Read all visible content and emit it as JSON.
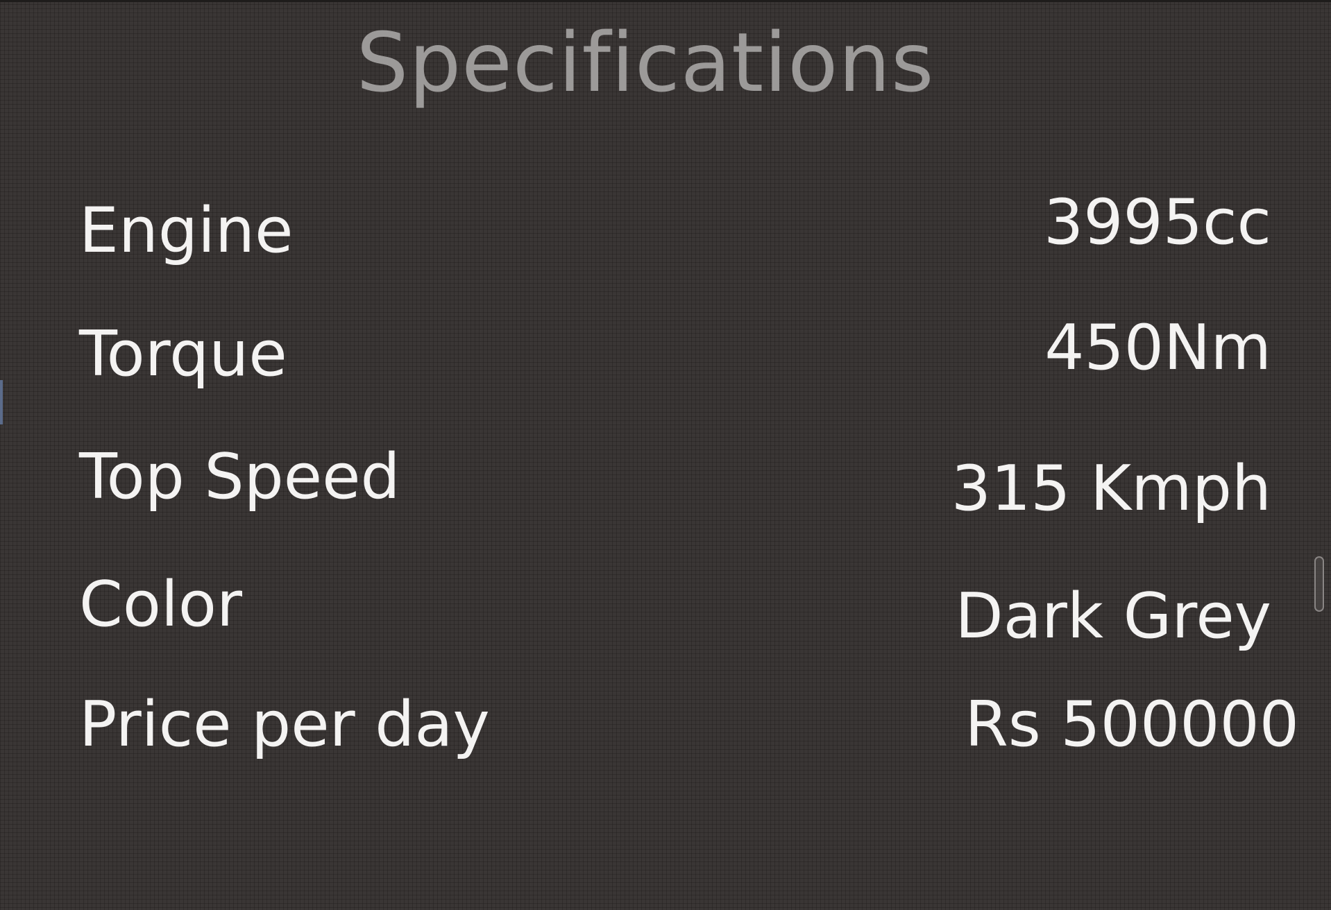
{
  "title": "Specifications",
  "specs": [
    {
      "label": "Engine",
      "value": "3995cc"
    },
    {
      "label": "Torque",
      "value": "450Nm"
    },
    {
      "label": "Top Speed",
      "value": "315 Kmph"
    },
    {
      "label": "Color",
      "value": "Dark Grey"
    },
    {
      "label": "Price per day",
      "value": "Rs 500000"
    }
  ],
  "colors": {
    "background": "#3a3635",
    "title_text": "#9c9a99",
    "spec_text": "#f4f3f2"
  }
}
